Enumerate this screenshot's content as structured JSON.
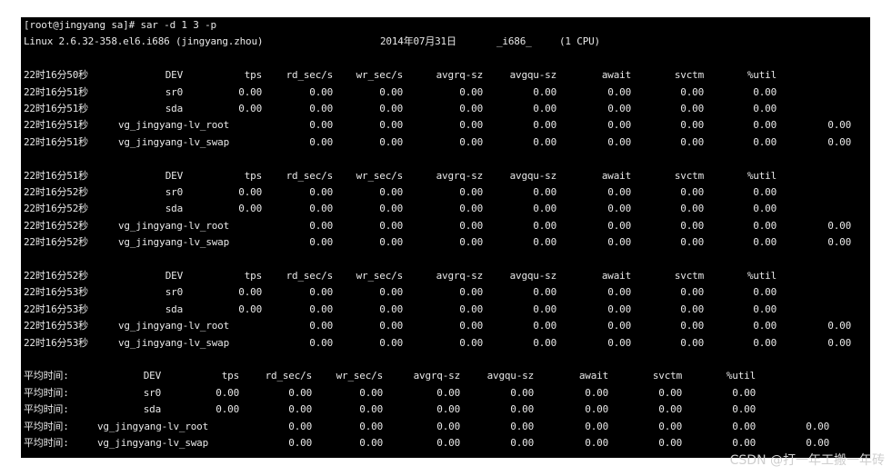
{
  "terminal": {
    "prompt_line": "[root@jingyang sa]# sar -d 1 3 -p",
    "system_info": "Linux 2.6.32-358.el6.i686 (jingyang.zhou)",
    "date": "2014年07月31日",
    "arch": "_i686_",
    "cpus": "(1 CPU)",
    "header_labels": [
      "DEV",
      "tps",
      "rd_sec/s",
      "wr_sec/s",
      "avgrq-sz",
      "avgqu-sz",
      "await",
      "svctm",
      "%util"
    ],
    "blocks": [
      {
        "header_time": "22时16分50秒",
        "rows": [
          {
            "time": "22时16分51秒",
            "dev": "sr0",
            "values": [
              "0.00",
              "0.00",
              "0.00",
              "0.00",
              "0.00",
              "0.00",
              "0.00",
              "0.00"
            ],
            "extra": ""
          },
          {
            "time": "22时16分51秒",
            "dev": "sda",
            "values": [
              "0.00",
              "0.00",
              "0.00",
              "0.00",
              "0.00",
              "0.00",
              "0.00",
              "0.00"
            ],
            "extra": ""
          },
          {
            "time": "22时16分51秒",
            "dev": "vg_jingyang-lv_root",
            "values": [
              "",
              "0.00",
              "0.00",
              "0.00",
              "0.00",
              "0.00",
              "0.00",
              "0.00"
            ],
            "extra": "0.00"
          },
          {
            "time": "22时16分51秒",
            "dev": "vg_jingyang-lv_swap",
            "values": [
              "",
              "0.00",
              "0.00",
              "0.00",
              "0.00",
              "0.00",
              "0.00",
              "0.00"
            ],
            "extra": "0.00"
          }
        ]
      },
      {
        "header_time": "22时16分51秒",
        "rows": [
          {
            "time": "22时16分52秒",
            "dev": "sr0",
            "values": [
              "0.00",
              "0.00",
              "0.00",
              "0.00",
              "0.00",
              "0.00",
              "0.00",
              "0.00"
            ],
            "extra": ""
          },
          {
            "time": "22时16分52秒",
            "dev": "sda",
            "values": [
              "0.00",
              "0.00",
              "0.00",
              "0.00",
              "0.00",
              "0.00",
              "0.00",
              "0.00"
            ],
            "extra": ""
          },
          {
            "time": "22时16分52秒",
            "dev": "vg_jingyang-lv_root",
            "values": [
              "",
              "0.00",
              "0.00",
              "0.00",
              "0.00",
              "0.00",
              "0.00",
              "0.00"
            ],
            "extra": "0.00"
          },
          {
            "time": "22时16分52秒",
            "dev": "vg_jingyang-lv_swap",
            "values": [
              "",
              "0.00",
              "0.00",
              "0.00",
              "0.00",
              "0.00",
              "0.00",
              "0.00"
            ],
            "extra": "0.00"
          }
        ]
      },
      {
        "header_time": "22时16分52秒",
        "rows": [
          {
            "time": "22时16分53秒",
            "dev": "sr0",
            "values": [
              "0.00",
              "0.00",
              "0.00",
              "0.00",
              "0.00",
              "0.00",
              "0.00",
              "0.00"
            ],
            "extra": ""
          },
          {
            "time": "22时16分53秒",
            "dev": "sda",
            "values": [
              "0.00",
              "0.00",
              "0.00",
              "0.00",
              "0.00",
              "0.00",
              "0.00",
              "0.00"
            ],
            "extra": ""
          },
          {
            "time": "22时16分53秒",
            "dev": "vg_jingyang-lv_root",
            "values": [
              "",
              "0.00",
              "0.00",
              "0.00",
              "0.00",
              "0.00",
              "0.00",
              "0.00"
            ],
            "extra": "0.00"
          },
          {
            "time": "22时16分53秒",
            "dev": "vg_jingyang-lv_swap",
            "values": [
              "",
              "0.00",
              "0.00",
              "0.00",
              "0.00",
              "0.00",
              "0.00",
              "0.00"
            ],
            "extra": "0.00"
          }
        ]
      }
    ],
    "average": {
      "label": "平均时间:",
      "rows": [
        {
          "time": "平均时间:",
          "dev": "sr0",
          "values": [
            "0.00",
            "0.00",
            "0.00",
            "0.00",
            "0.00",
            "0.00",
            "0.00",
            "0.00"
          ],
          "extra": ""
        },
        {
          "time": "平均时间:",
          "dev": "sda",
          "values": [
            "0.00",
            "0.00",
            "0.00",
            "0.00",
            "0.00",
            "0.00",
            "0.00",
            "0.00"
          ],
          "extra": ""
        },
        {
          "time": "平均时间:",
          "dev": "vg_jingyang-lv_root",
          "values": [
            "",
            "0.00",
            "0.00",
            "0.00",
            "0.00",
            "0.00",
            "0.00",
            "0.00"
          ],
          "extra": "0.00"
        },
        {
          "time": "平均时间:",
          "dev": "vg_jingyang-lv_swap",
          "values": [
            "",
            "0.00",
            "0.00",
            "0.00",
            "0.00",
            "0.00",
            "0.00",
            "0.00"
          ],
          "extra": "0.00"
        }
      ]
    }
  },
  "watermark": "CSDN @打一年工搬一年砖"
}
